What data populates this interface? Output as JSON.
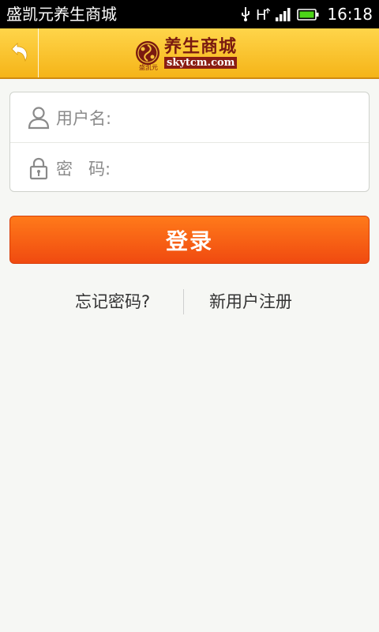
{
  "status_bar": {
    "app_name": "盛凯元养生商城",
    "time": "16:18",
    "icons": [
      "usb-icon",
      "hsdpa-icon",
      "signal-icon",
      "battery-icon"
    ],
    "network_label": "H"
  },
  "header": {
    "back_icon": "back-arrow-icon",
    "logo": {
      "text_cn": "养生商城",
      "url": "skytcm.com",
      "sub": "盛凯元"
    },
    "colors": {
      "gradient_top": "#ffd54a",
      "gradient_bottom": "#f5b418"
    }
  },
  "login_form": {
    "username_label": "用户名:",
    "username_value": "",
    "password_label": "密   码:",
    "password_value": "",
    "username_icon": "user-icon",
    "password_icon": "lock-icon"
  },
  "login_button": {
    "label": "登录",
    "color": "#f05a12"
  },
  "links": {
    "forgot_password": "忘记密码?",
    "register": "新用户注册"
  }
}
